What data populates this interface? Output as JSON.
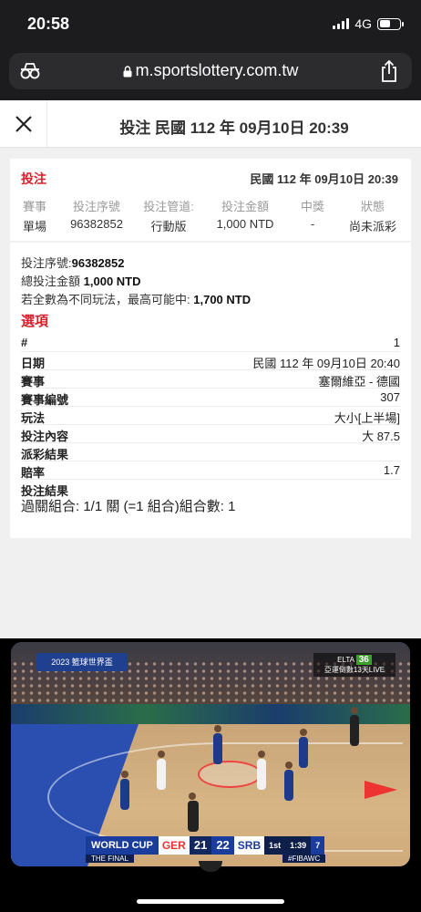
{
  "status_bar": {
    "time": "20:58",
    "network": "4G"
  },
  "browser": {
    "url": "m.sportslottery.com.tw"
  },
  "header": {
    "title": "投注 民國 112 年 09月10日 20:39"
  },
  "summary": {
    "label": "投注",
    "date": "民國 112 年 09月10日 20:39",
    "columns": [
      {
        "header": "賽事",
        "value": "單場"
      },
      {
        "header": "投注序號",
        "value": "96382852"
      },
      {
        "header": "投注管道:",
        "value": "行動版"
      },
      {
        "header": "投注金額",
        "value": "1,000 NTD"
      },
      {
        "header": "中獎",
        "value": "-"
      },
      {
        "header": "狀態",
        "value": "尚未派彩"
      }
    ]
  },
  "detail": {
    "serial_label": "投注序號:",
    "serial_value": "96382852",
    "total_label": "總投注金額",
    "total_value": "1,000 NTD",
    "max_label": "若全數為不同玩法，最高可能中:",
    "max_value": "1,700 NTD",
    "options_title": "選項",
    "rows": [
      {
        "key": "#",
        "value": "1"
      },
      {
        "key": "日期",
        "value": "民國 112 年 09月10日 20:40"
      },
      {
        "key": "賽事",
        "value": "塞爾維亞 - 德國"
      },
      {
        "key": "賽事編號",
        "value": "307"
      },
      {
        "key": "玩法",
        "value": "大小[上半場]"
      },
      {
        "key": "投注內容",
        "value": "大 87.5"
      },
      {
        "key": "派彩結果",
        "value": ""
      },
      {
        "key": "賠率",
        "value": "1.7"
      },
      {
        "key": "投注結果",
        "value": ""
      }
    ],
    "parlay": "過關組合: 1/1 關 (=1 組合)組合數: 1"
  },
  "video": {
    "tv_logo": "2023 籃球世界盃",
    "channel": {
      "name": "ELTA",
      "number": "36",
      "caption": "亞運倒數13天LIVE"
    },
    "scorebug": {
      "event": "WORLD CUP",
      "team1": "GER",
      "score1": "21",
      "score2": "22",
      "team2": "SRB",
      "quarter": "1st",
      "clock": "1:39",
      "shot": "7",
      "sub": "THE FINAL",
      "hashtag": "#FIBAWC"
    }
  }
}
